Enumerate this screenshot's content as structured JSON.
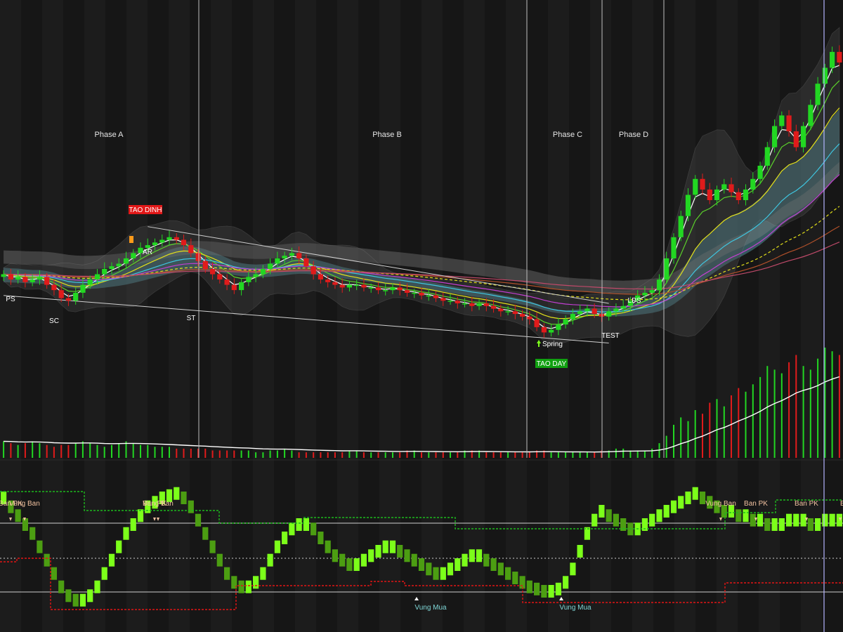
{
  "chart_data": {
    "type": "candlestick",
    "title": "",
    "xlabel": "",
    "ylabel": "",
    "grid": false,
    "colors": {
      "background": "#161616",
      "bull_candle": "#22d722",
      "bear_candle": "#e01b1b",
      "divider": "#bfbfbf",
      "ema_white": "#ffffff",
      "ema_green": "#5bd12a",
      "ema_yellow": "#e3e01a",
      "ema_cyan": "#3fc6e0",
      "ema_magenta": "#c23fd1",
      "ema_brown": "#b0502a",
      "ema_pink": "#c04a6a",
      "cloud_teal": "#5aa7b4",
      "cloud_gray": "#8c8c8c",
      "label_red_bg": "#e21818",
      "label_green_bg": "#10a010",
      "osc_bright": "#7cff1a",
      "osc_dark": "#4c9e12",
      "resistance_green": "#1db81d",
      "support_red": "#e01515"
    },
    "phases": [
      {
        "label": "Phase A"
      },
      {
        "label": "Phase B"
      },
      {
        "label": "Phase C"
      },
      {
        "label": "Phase D"
      }
    ],
    "events": [
      {
        "label": "PS"
      },
      {
        "label": "SC"
      },
      {
        "label": "AR"
      },
      {
        "label": "ST"
      },
      {
        "label": "Spring"
      },
      {
        "label": "TEST"
      },
      {
        "label": "LPS"
      }
    ],
    "signals": [
      {
        "label": "TAO DINH",
        "kind": "top"
      },
      {
        "label": "TAO DAY",
        "kind": "bottom"
      }
    ],
    "price_series": {
      "name": "",
      "close": [
        10.2,
        10.0,
        10.1,
        9.9,
        10.0,
        10.1,
        9.8,
        9.6,
        9.3,
        9.2,
        9.5,
        9.8,
        10.0,
        10.2,
        10.4,
        10.5,
        10.6,
        10.8,
        11.0,
        11.2,
        11.3,
        11.4,
        11.5,
        11.6,
        11.5,
        11.3,
        11.0,
        10.7,
        10.4,
        10.2,
        10.0,
        9.8,
        9.6,
        9.9,
        10.1,
        10.2,
        10.4,
        10.6,
        10.8,
        10.9,
        11.0,
        10.8,
        10.5,
        10.2,
        10.0,
        9.9,
        9.8,
        9.7,
        9.8,
        9.8,
        9.7,
        9.7,
        9.6,
        9.6,
        9.7,
        9.6,
        9.5,
        9.5,
        9.4,
        9.4,
        9.3,
        9.2,
        9.2,
        9.1,
        9.1,
        9.0,
        9.1,
        9.0,
        8.9,
        8.8,
        8.8,
        8.7,
        8.6,
        8.5,
        8.2,
        8.0,
        8.1,
        8.3,
        8.5,
        8.7,
        8.8,
        8.9,
        8.7,
        8.6,
        8.8,
        8.9,
        9.0,
        9.2,
        9.4,
        9.5,
        9.6,
        10.0,
        10.8,
        11.6,
        12.4,
        13.2,
        13.8,
        13.4,
        13.0,
        13.4,
        13.6,
        13.3,
        13.0,
        13.4,
        13.8,
        14.3,
        15.0,
        15.8,
        16.2,
        15.6,
        15.0,
        15.8,
        16.6,
        17.4,
        18.0,
        18.6,
        18.2
      ],
      "ohlc_note": ""
    },
    "volume_panel": {
      "volumes": [
        9,
        8,
        7,
        8,
        9,
        8,
        7,
        6,
        7,
        7,
        8,
        9,
        8,
        7,
        6,
        7,
        8,
        9,
        8,
        7,
        7,
        6,
        6,
        6,
        5,
        5,
        5,
        5,
        5,
        4,
        4,
        4,
        4,
        4,
        4,
        3,
        3,
        4,
        4,
        5,
        4,
        3,
        3,
        3,
        3,
        3,
        3,
        3,
        4,
        4,
        3,
        3,
        3,
        3,
        3,
        3,
        4,
        4,
        3,
        3,
        3,
        3,
        3,
        3,
        4,
        4,
        4,
        3,
        3,
        3,
        3,
        3,
        3,
        3,
        4,
        4,
        3,
        3,
        3,
        3,
        3,
        3,
        3,
        4,
        4,
        5,
        5,
        4,
        4,
        4,
        5,
        8,
        12,
        18,
        22,
        20,
        26,
        24,
        30,
        32,
        28,
        34,
        38,
        36,
        40,
        44,
        50,
        48,
        46,
        52,
        56,
        50,
        48,
        54,
        60,
        58,
        56
      ],
      "ma_note": ""
    },
    "oscillator": {
      "labels_top": [
        {
          "label": "Ban PK"
        },
        {
          "label": "Vung Ban"
        },
        {
          "label": "Ban PK"
        },
        {
          "label": "Vung Ban"
        },
        {
          "label": "Vung Ban"
        },
        {
          "label": "Ban PK"
        },
        {
          "label": "Ban PK"
        },
        {
          "label": "B"
        }
      ],
      "labels_bottom": [
        {
          "label": "Vung Mua"
        },
        {
          "label": "Vung Mua"
        }
      ],
      "values": [
        74,
        70,
        66,
        62,
        58,
        52,
        46,
        40,
        34,
        30,
        28,
        28,
        30,
        34,
        40,
        46,
        52,
        58,
        62,
        66,
        70,
        72,
        74,
        75,
        76,
        74,
        70,
        64,
        58,
        52,
        46,
        40,
        36,
        34,
        34,
        36,
        40,
        46,
        52,
        56,
        60,
        62,
        62,
        60,
        56,
        52,
        48,
        46,
        44,
        44,
        46,
        48,
        50,
        52,
        52,
        50,
        48,
        46,
        44,
        42,
        40,
        40,
        42,
        44,
        46,
        48,
        48,
        46,
        44,
        42,
        40,
        38,
        36,
        34,
        33,
        32,
        32,
        33,
        36,
        42,
        50,
        58,
        64,
        68,
        66,
        64,
        62,
        60,
        60,
        62,
        64,
        66,
        68,
        70,
        72,
        74,
        76,
        74,
        72,
        70,
        68,
        68,
        66,
        66,
        64,
        64,
        62,
        62,
        62,
        64,
        64,
        64,
        62,
        62,
        64,
        64,
        64
      ]
    }
  },
  "title": "",
  "subtitle": "",
  "watermark": ""
}
